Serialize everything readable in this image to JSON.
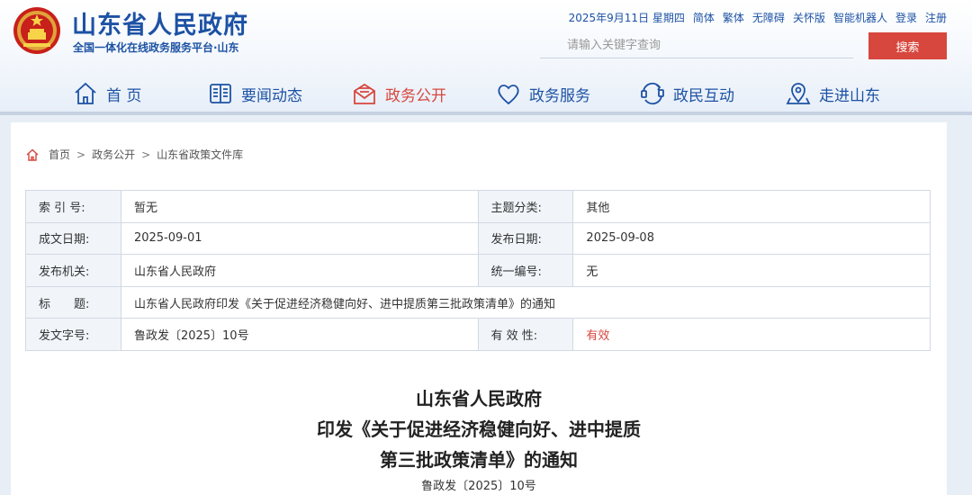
{
  "header": {
    "site_title": "山东省人民政府",
    "site_subtitle": "全国一体化在线政务服务平台·山东",
    "top_links": [
      "2025年9月11日 星期四",
      "简体",
      "繁体",
      "无障碍",
      "关怀版",
      "智能机器人",
      "登录",
      "注册"
    ],
    "search": {
      "placeholder": "请输入关键字查询",
      "button_label": "搜索"
    }
  },
  "nav": {
    "items": [
      {
        "label": "首 页",
        "icon": "home-icon"
      },
      {
        "label": "要闻动态",
        "icon": "newspaper-icon"
      },
      {
        "label": "政务公开",
        "icon": "mail-icon",
        "active": true
      },
      {
        "label": "政务服务",
        "icon": "heart-icon"
      },
      {
        "label": "政民互动",
        "icon": "interaction-icon"
      },
      {
        "label": "走进山东",
        "icon": "map-pin-icon"
      }
    ]
  },
  "breadcrumb": {
    "icon": "home-icon",
    "items": [
      "首页",
      "政务公开",
      "山东省政策文件库"
    ],
    "separator": ">"
  },
  "meta": {
    "rows": [
      {
        "l1": "索 引 号:",
        "v1": "暂无",
        "l2": "主题分类:",
        "v2": "其他"
      },
      {
        "l1": "成文日期:",
        "v1": "2025-09-01",
        "l2": "发布日期:",
        "v2": "2025-09-08"
      },
      {
        "l1": "发布机关:",
        "v1": "山东省人民政府",
        "l2": "统一编号:",
        "v2": "无"
      },
      {
        "l1": "标　　题:",
        "v1": "山东省人民政府印发《关于促进经济稳健向好、进中提质第三批政策清单》的通知"
      },
      {
        "l1": "发文字号:",
        "v1": "鲁政发〔2025〕10号",
        "l2": "有 效 性:",
        "v2": "有效"
      }
    ]
  },
  "document": {
    "title_lines": [
      "山东省人民政府",
      "印发《关于促进经济稳健向好、进中提质",
      "第三批政策清单》的通知"
    ],
    "doc_number": "鲁政发〔2025〕10号"
  },
  "colors": {
    "brand_blue": "#1d52a4",
    "accent_red": "#d7473d"
  }
}
